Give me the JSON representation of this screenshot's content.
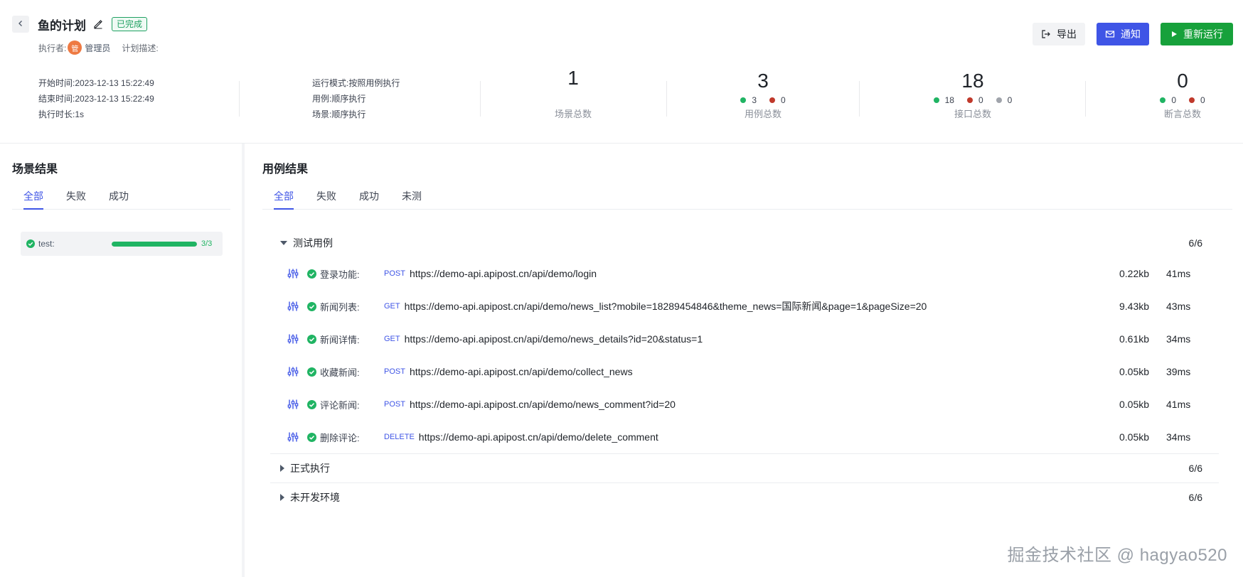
{
  "header": {
    "plan_name": "鱼的计划",
    "status": "已完成",
    "executor_label": "执行者:",
    "executor_avatar_text": "管",
    "executor_name": "管理员",
    "description_label": "计划描述:",
    "buttons": {
      "export": "导出",
      "notify": "通知",
      "rerun": "重新运行"
    }
  },
  "info": {
    "start_time": "开始时间:2023-12-13 15:22:49",
    "end_time": "结束时间:2023-12-13 15:22:49",
    "duration": "执行时长:1s",
    "run_mode": "运行模式:按照用例执行",
    "case_mode": "用例:顺序执行",
    "scene_mode": "场景:顺序执行"
  },
  "stats": {
    "scenes": {
      "value": "1",
      "label": "场景总数"
    },
    "cases": {
      "value": "3",
      "label": "用例总数",
      "success": "3",
      "fail": "0"
    },
    "apis": {
      "value": "18",
      "label": "接口总数",
      "success": "18",
      "fail": "0",
      "skip": "0"
    },
    "asserts": {
      "value": "0",
      "label": "断言总数",
      "success": "0",
      "fail": "0"
    }
  },
  "scene_panel": {
    "title": "场景结果",
    "tabs": [
      "全部",
      "失败",
      "成功"
    ],
    "scenes": [
      {
        "name": "test:",
        "progress": 1.0,
        "progress_text": "3/3"
      }
    ]
  },
  "case_panel": {
    "title": "用例结果",
    "tabs": [
      "全部",
      "失败",
      "成功",
      "未测"
    ],
    "groups": [
      {
        "name": "测试用例",
        "count": "6/6",
        "expanded": true,
        "items": [
          {
            "name": "登录功能:",
            "method": "POST",
            "url": "https://demo-api.apipost.cn/api/demo/login",
            "size": "0.22kb",
            "time": "41ms"
          },
          {
            "name": "新闻列表:",
            "method": "GET",
            "url": "https://demo-api.apipost.cn/api/demo/news_list?mobile=18289454846&theme_news=国际新闻&page=1&pageSize=20",
            "size": "9.43kb",
            "time": "43ms"
          },
          {
            "name": "新闻详情:",
            "method": "GET",
            "url": "https://demo-api.apipost.cn/api/demo/news_details?id=20&status=1",
            "size": "0.61kb",
            "time": "34ms"
          },
          {
            "name": "收藏新闻:",
            "method": "POST",
            "url": "https://demo-api.apipost.cn/api/demo/collect_news",
            "size": "0.05kb",
            "time": "39ms"
          },
          {
            "name": "评论新闻:",
            "method": "POST",
            "url": "https://demo-api.apipost.cn/api/demo/news_comment?id=20",
            "size": "0.05kb",
            "time": "41ms"
          },
          {
            "name": "删除评论:",
            "method": "DELETE",
            "url": "https://demo-api.apipost.cn/api/demo/delete_comment",
            "size": "0.05kb",
            "time": "34ms"
          }
        ]
      },
      {
        "name": "正式执行",
        "count": "6/6",
        "expanded": false
      },
      {
        "name": "未开发环境",
        "count": "6/6",
        "expanded": false
      }
    ]
  },
  "watermark": "掘金技术社区 @ hagyao520",
  "colors": {
    "accent": "#3f55e6",
    "success": "#20b463",
    "fail": "#c0392b",
    "rerun": "#17a13b"
  }
}
